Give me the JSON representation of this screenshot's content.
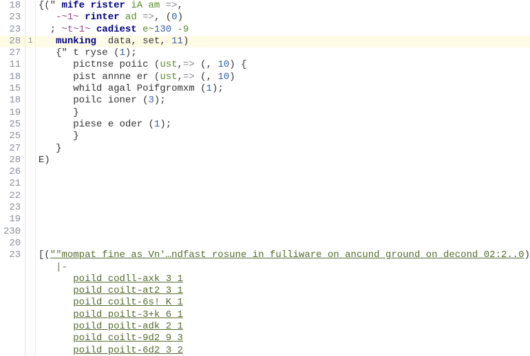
{
  "gutter": [
    "18",
    "23",
    "23",
    "28",
    "27",
    "11",
    "18",
    "15",
    "18",
    "19",
    "25",
    "25",
    "27",
    "28",
    "26",
    "21",
    "22",
    "23",
    "19",
    "230",
    "20",
    "23",
    "",
    "",
    "",
    "",
    "",
    "",
    "",
    ""
  ],
  "folds": [
    "",
    "",
    "",
    "1",
    "",
    "",
    "",
    "",
    "",
    "",
    "",
    "",
    "",
    "",
    "",
    "",
    "",
    "",
    "",
    "",
    "",
    "",
    "",
    "",
    "",
    "",
    "",
    "",
    "",
    ""
  ],
  "highlighted_line_index": 3,
  "lines": [
    {
      "indent": "",
      "tokens": [
        {
          "t": "{(\" ",
          "c": "brk"
        },
        {
          "t": "mife rister",
          "c": "kw"
        },
        {
          "t": " iA am ",
          "c": "grn"
        },
        {
          "t": "=>",
          "c": "op"
        },
        {
          "t": ",",
          "c": "brk"
        }
      ]
    },
    {
      "indent": "   ",
      "tokens": [
        {
          "t": "-~1~ ",
          "c": "dash"
        },
        {
          "t": "rinter",
          "c": "kw"
        },
        {
          "t": " ad ",
          "c": "grn"
        },
        {
          "t": "=>",
          "c": "op"
        },
        {
          "t": ", ",
          "c": "brk"
        },
        {
          "t": "(",
          "c": "brk"
        },
        {
          "t": "0",
          "c": "num"
        },
        {
          "t": ")",
          "c": "brk"
        }
      ]
    },
    {
      "indent": "  ; ",
      "tokens": [
        {
          "t": "~t~1~ ",
          "c": "dash"
        },
        {
          "t": "cadiest",
          "c": "kw"
        },
        {
          "t": " e~",
          "c": "grn"
        },
        {
          "t": "130 ",
          "c": "num"
        },
        {
          "t": "-9",
          "c": "grn"
        }
      ]
    },
    {
      "indent": "   ",
      "tokens": [
        {
          "t": "munking",
          "c": "kw"
        },
        {
          "t": "  data",
          "c": "id"
        },
        {
          "t": ", ",
          "c": "brk"
        },
        {
          "t": "set",
          "c": "id"
        },
        {
          "t": ", ",
          "c": "brk"
        },
        {
          "t": "11",
          "c": "num"
        },
        {
          "t": ")",
          "c": "brk"
        }
      ]
    },
    {
      "indent": "   ",
      "tokens": [
        {
          "t": "{\" t ryse ",
          "c": "id"
        },
        {
          "t": "(",
          "c": "brk"
        },
        {
          "t": "1",
          "c": "num"
        },
        {
          "t": ");",
          "c": "brk"
        }
      ]
    },
    {
      "indent": "      ",
      "tokens": [
        {
          "t": "pictnse poiic ",
          "c": "id"
        },
        {
          "t": "(",
          "c": "brk"
        },
        {
          "t": "ust",
          "c": "grn"
        },
        {
          "t": ",",
          "c": "brk"
        },
        {
          "t": "=> ",
          "c": "op"
        },
        {
          "t": "(",
          "c": "brk"
        },
        {
          "t": ", ",
          "c": "brk"
        },
        {
          "t": "10",
          "c": "num"
        },
        {
          "t": ") {",
          "c": "brk"
        }
      ]
    },
    {
      "indent": "      ",
      "tokens": [
        {
          "t": "pist annne er ",
          "c": "id"
        },
        {
          "t": "(",
          "c": "brk"
        },
        {
          "t": "ust",
          "c": "grn"
        },
        {
          "t": ",",
          "c": "brk"
        },
        {
          "t": "=> ",
          "c": "op"
        },
        {
          "t": "(",
          "c": "brk"
        },
        {
          "t": ", ",
          "c": "brk"
        },
        {
          "t": "10",
          "c": "num"
        },
        {
          "t": ")",
          "c": "brk"
        }
      ]
    },
    {
      "indent": "      ",
      "tokens": [
        {
          "t": "whild agal Poifgromxm ",
          "c": "id"
        },
        {
          "t": "(",
          "c": "brk"
        },
        {
          "t": "1",
          "c": "num"
        },
        {
          "t": ");",
          "c": "brk"
        }
      ]
    },
    {
      "indent": "      ",
      "tokens": [
        {
          "t": "poilc ioner ",
          "c": "id"
        },
        {
          "t": "(",
          "c": "brk"
        },
        {
          "t": "3",
          "c": "num"
        },
        {
          "t": ");",
          "c": "brk"
        }
      ]
    },
    {
      "indent": "      ",
      "tokens": [
        {
          "t": "}",
          "c": "brk"
        }
      ]
    },
    {
      "indent": "      ",
      "tokens": [
        {
          "t": "piese e oder ",
          "c": "id"
        },
        {
          "t": "(",
          "c": "brk"
        },
        {
          "t": "1",
          "c": "num"
        },
        {
          "t": ");",
          "c": "brk"
        }
      ]
    },
    {
      "indent": "      ",
      "tokens": [
        {
          "t": "}",
          "c": "brk"
        }
      ]
    },
    {
      "indent": "   ",
      "tokens": [
        {
          "t": "}",
          "c": "brk"
        }
      ]
    },
    {
      "indent": "",
      "tokens": [
        {
          "t": "E)",
          "c": "brk"
        }
      ]
    },
    {
      "indent": "",
      "tokens": []
    },
    {
      "indent": "",
      "tokens": []
    },
    {
      "indent": "",
      "tokens": []
    },
    {
      "indent": "",
      "tokens": []
    },
    {
      "indent": "",
      "tokens": []
    },
    {
      "indent": "",
      "tokens": []
    },
    {
      "indent": "",
      "tokens": []
    },
    {
      "indent": "",
      "tokens": [
        {
          "t": "[(",
          "c": "brk"
        },
        {
          "t": "\"\"mompat fine as Vn'…ndfast rosune in fulliware on ancund ground on decond 02:2..0",
          "c": "under"
        },
        {
          "t": ")",
          "c": "brk"
        }
      ]
    },
    {
      "indent": "   ",
      "tokens": [
        {
          "t": "|-",
          "c": "cmt"
        }
      ]
    },
    {
      "indent": "      ",
      "tokens": [
        {
          "t": "poild codll-axk 3 1",
          "c": "under"
        }
      ]
    },
    {
      "indent": "      ",
      "tokens": [
        {
          "t": "poild coilt-at2 3 1",
          "c": "under"
        }
      ]
    },
    {
      "indent": "      ",
      "tokens": [
        {
          "t": "poild coilt-6s! K 1",
          "c": "under"
        }
      ]
    },
    {
      "indent": "      ",
      "tokens": [
        {
          "t": "poild poilt-3+k 6 1",
          "c": "under"
        }
      ]
    },
    {
      "indent": "      ",
      "tokens": [
        {
          "t": "poild poilt-adk 2 1",
          "c": "under"
        }
      ]
    },
    {
      "indent": "      ",
      "tokens": [
        {
          "t": "poild coilt-9d2 9 3",
          "c": "under"
        }
      ]
    },
    {
      "indent": "      ",
      "tokens": [
        {
          "t": "poild poilt-6d2 3 2",
          "c": "under"
        }
      ]
    }
  ]
}
